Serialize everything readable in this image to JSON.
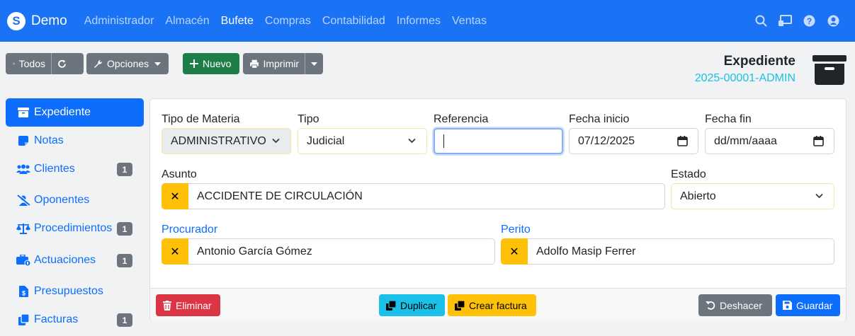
{
  "navbar": {
    "brand": "Demo",
    "menu": [
      {
        "label": "Administrador",
        "active": false
      },
      {
        "label": "Almacén",
        "active": false
      },
      {
        "label": "Bufete",
        "active": true
      },
      {
        "label": "Compras",
        "active": false
      },
      {
        "label": "Contabilidad",
        "active": false
      },
      {
        "label": "Informes",
        "active": false
      },
      {
        "label": "Ventas",
        "active": false
      }
    ],
    "icons": [
      "search-icon",
      "monitor-icon",
      "help-icon",
      "user-icon"
    ]
  },
  "toolbar": {
    "todos": "Todos",
    "opciones": "Opciones",
    "nuevo": "Nuevo",
    "imprimir": "Imprimir"
  },
  "header": {
    "title": "Expediente",
    "code": "2025-00001-ADMIN"
  },
  "sidebar": {
    "items": [
      {
        "label": "Expediente",
        "icon": "archive-icon",
        "badge": ""
      },
      {
        "label": "Notas",
        "icon": "note-icon",
        "badge": ""
      },
      {
        "label": "Clientes",
        "icon": "users-icon",
        "badge": "1"
      },
      {
        "label": "Oponentes",
        "icon": "user-slash-icon",
        "badge": ""
      },
      {
        "label": "Procedimientos",
        "icon": "scale-icon",
        "badge": "1"
      },
      {
        "label": "Actuaciones",
        "icon": "briefcase-icon",
        "badge": "1"
      },
      {
        "label": "Presupuestos",
        "icon": "invoice-dollar-icon",
        "badge": ""
      },
      {
        "label": "Facturas",
        "icon": "copy-icon",
        "badge": "1"
      }
    ]
  },
  "form": {
    "tipo_materia": {
      "label": "Tipo de Materia",
      "value": "ADMINISTRATIVO"
    },
    "tipo": {
      "label": "Tipo",
      "value": "Judicial"
    },
    "referencia": {
      "label": "Referencia",
      "value": ""
    },
    "fecha_inicio": {
      "label": "Fecha inicio",
      "value": "07/12/2025"
    },
    "fecha_fin": {
      "label": "Fecha fin",
      "placeholder": "dd/mm/aaaa"
    },
    "asunto": {
      "label": "Asunto",
      "value": "ACCIDENTE DE CIRCULACIÓN"
    },
    "estado": {
      "label": "Estado",
      "value": "Abierto"
    },
    "procurador": {
      "label": "Procurador",
      "value": "Antonio García Gómez"
    },
    "perito": {
      "label": "Perito",
      "value": "Adolfo Masip Ferrer"
    }
  },
  "actions": {
    "eliminar": "Eliminar",
    "duplicar": "Duplicar",
    "crear_factura": "Crear factura",
    "deshacer": "Deshacer",
    "guardar": "Guardar"
  },
  "clear_symbol": "✕",
  "colors": {
    "navbar": "#1a73f5",
    "primary": "#0d6efd",
    "success": "#1e7e48",
    "danger": "#dc3545",
    "info": "#1ac0e8",
    "warning": "#ffc107",
    "secondary": "#6c757d"
  }
}
